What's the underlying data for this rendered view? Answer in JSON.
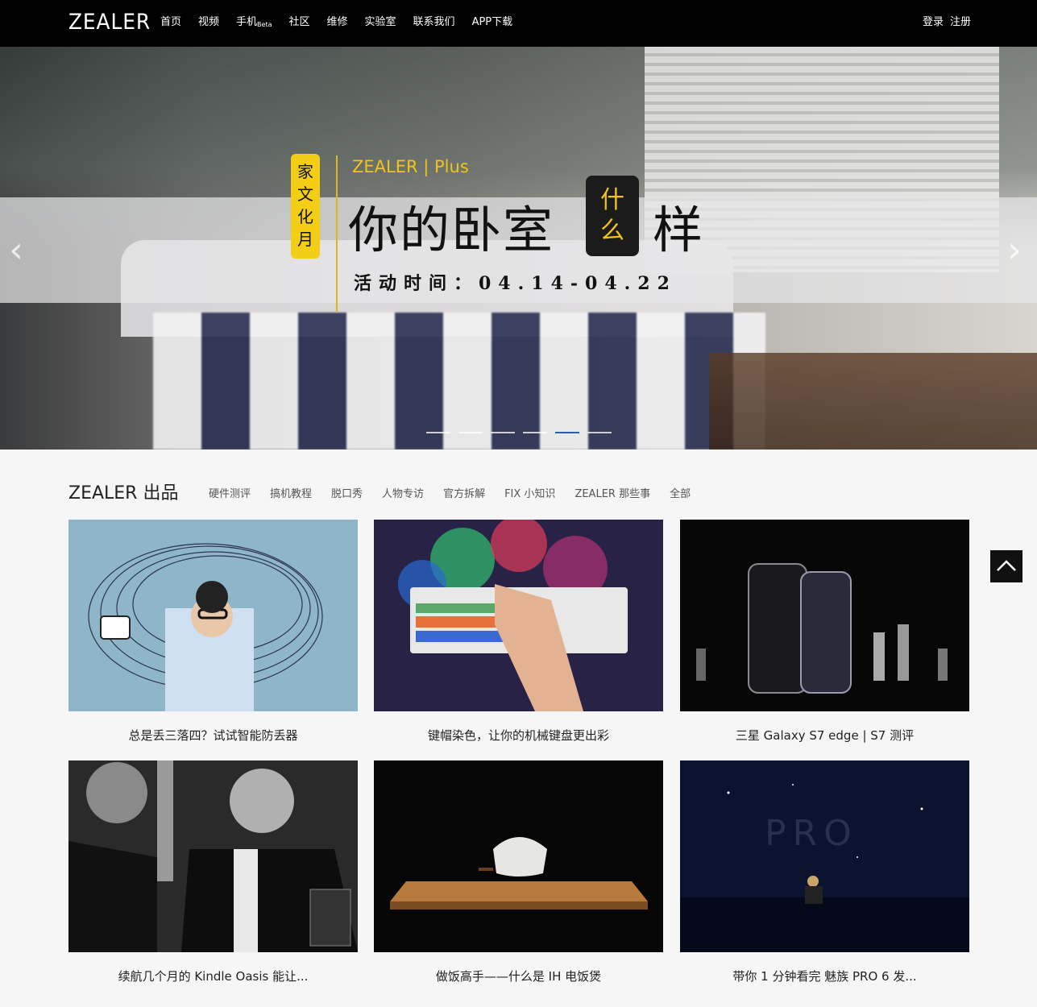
{
  "header": {
    "logo": "ZEALER",
    "nav": [
      {
        "label": "首页"
      },
      {
        "label": "视频"
      },
      {
        "label": "手机",
        "badge": "Beta"
      },
      {
        "label": "社区"
      },
      {
        "label": "维修"
      },
      {
        "label": "实验室"
      },
      {
        "label": "联系我们"
      },
      {
        "label": "APP下载"
      }
    ],
    "login": "登录",
    "register": "注册"
  },
  "hero": {
    "tag": "家文化月",
    "brand": "ZEALER | Plus",
    "title_main": "你的卧室",
    "title_box": "什么",
    "title_end": "样",
    "date": "活动时间：04.14-04.22",
    "prev_icon": "chevron-left-icon",
    "next_icon": "chevron-right-icon",
    "slides_total": 6,
    "active_slide": 5
  },
  "section": {
    "title": "ZEALER 出品",
    "filters": [
      "硬件测评",
      "搞机教程",
      "脱口秀",
      "人物专访",
      "官方拆解",
      "FIX 小知识",
      "ZEALER 那些事",
      "全部"
    ]
  },
  "videos": [
    {
      "title": "总是丢三落四？试试智能防丢器"
    },
    {
      "title": "键帽染色，让你的机械键盘更出彩"
    },
    {
      "title": "三星 Galaxy S7 edge | S7 测评"
    },
    {
      "title": "续航几个月的 Kindle Oasis 能让..."
    },
    {
      "title": "做饭高手——什么是 IH 电饭煲"
    },
    {
      "title": "带你 1 分钟看完 魅族 PRO 6 发...",
      "thumb_text": "PRO"
    }
  ],
  "back_to_top_icon": "chevron-up-icon",
  "colors": {
    "accent_yellow": "#f3ce14",
    "header_bg": "#000000",
    "active_dot": "#2b5ea8"
  }
}
